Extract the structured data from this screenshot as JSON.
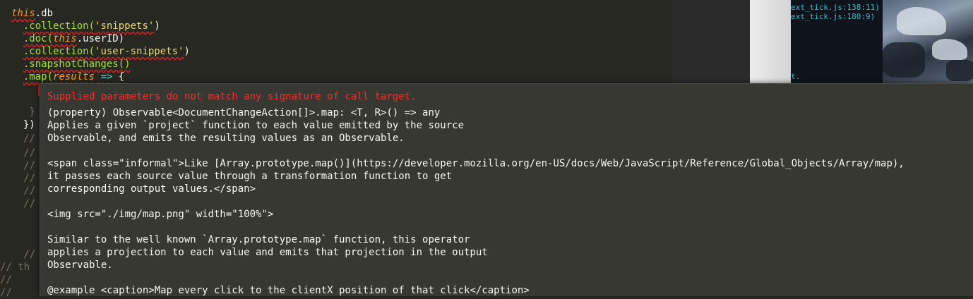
{
  "editor": {
    "lines": [
      {
        "id": "l1",
        "parts": [
          {
            "t": "this",
            "c": "tok-this"
          },
          {
            "t": ".db",
            "c": "tok-punct"
          }
        ]
      },
      {
        "id": "l2",
        "parts": [
          {
            "t": "  ",
            "c": "tok-punct"
          },
          {
            "t": ".collection(",
            "c": "tok-method"
          },
          {
            "t": "'snippets'",
            "c": "tok-string"
          },
          {
            "t": ")",
            "c": "tok-punct"
          }
        ]
      },
      {
        "id": "l3",
        "parts": [
          {
            "t": "  ",
            "c": "tok-punct"
          },
          {
            "t": ".doc(",
            "c": "tok-method"
          },
          {
            "t": "this",
            "c": "tok-this"
          },
          {
            "t": ".userID)",
            "c": "tok-punct"
          }
        ]
      },
      {
        "id": "l4",
        "parts": [
          {
            "t": "  ",
            "c": "tok-punct"
          },
          {
            "t": ".collection(",
            "c": "tok-method"
          },
          {
            "t": "'user-snippets'",
            "c": "tok-string"
          },
          {
            "t": ")",
            "c": "tok-punct"
          }
        ]
      },
      {
        "id": "l5",
        "parts": [
          {
            "t": "  ",
            "c": "tok-punct"
          },
          {
            "t": ".snapshotChanges()",
            "c": "tok-method"
          }
        ]
      },
      {
        "id": "l6",
        "parts": [
          {
            "t": "  ",
            "c": "tok-punct"
          },
          {
            "t": ".map(",
            "c": "tok-method"
          },
          {
            "t": "results",
            "c": "tok-this"
          },
          {
            "t": " => ",
            "c": "tok-arrow"
          },
          {
            "t": "{",
            "c": "tok-punct"
          }
        ]
      }
    ],
    "left_fragments": [
      {
        "id": "f1",
        "text": "   }"
      },
      {
        "id": "f2",
        "text": "  })"
      },
      {
        "id": "f3",
        "text": "  //"
      },
      {
        "id": "f4",
        "text": "   //"
      },
      {
        "id": "f5",
        "text": "   //"
      },
      {
        "id": "f6",
        "text": "   //"
      },
      {
        "id": "f7",
        "text": "   //"
      },
      {
        "id": "f8",
        "text": "   //"
      },
      {
        "id": "f9",
        "text": "   //"
      },
      {
        "id": "f10",
        "text": "// th"
      },
      {
        "id": "f11",
        "text": "//"
      },
      {
        "id": "f12",
        "text": "//"
      }
    ]
  },
  "terminal": {
    "lines": [
      "ext_tick.js:138:11)",
      "ext_tick.js:180:9)",
      "t."
    ]
  },
  "tooltip": {
    "error": "Supplied parameters do not match any signature of call target.",
    "lines": [
      "(property) Observable<DocumentChangeAction[]>.map: <T, R>() => any",
      "Applies a given `project` function to each value emitted by the source",
      "Observable, and emits the resulting values as an Observable.",
      "",
      "<span class=\"informal\">Like [Array.prototype.map()](https://developer.mozilla.org/en-US/docs/Web/JavaScript/Reference/Global_Objects/Array/map),",
      "it passes each source value through a transformation function to get",
      "corresponding output values.</span>",
      "",
      "<img src=\"./img/map.png\" width=\"100%\">",
      "",
      "Similar to the well known `Array.prototype.map` function, this operator",
      "applies a projection to each value and emits that projection in the output",
      "Observable.",
      "",
      "@example <caption>Map every click to the clientX position of that click</caption>"
    ]
  },
  "colors": {
    "background": "#272822",
    "tooltip_bg": "#373832",
    "error": "#ff2a2a",
    "keyword_this": "#fd971f",
    "method": "#a6e22e",
    "string": "#e6db74"
  }
}
